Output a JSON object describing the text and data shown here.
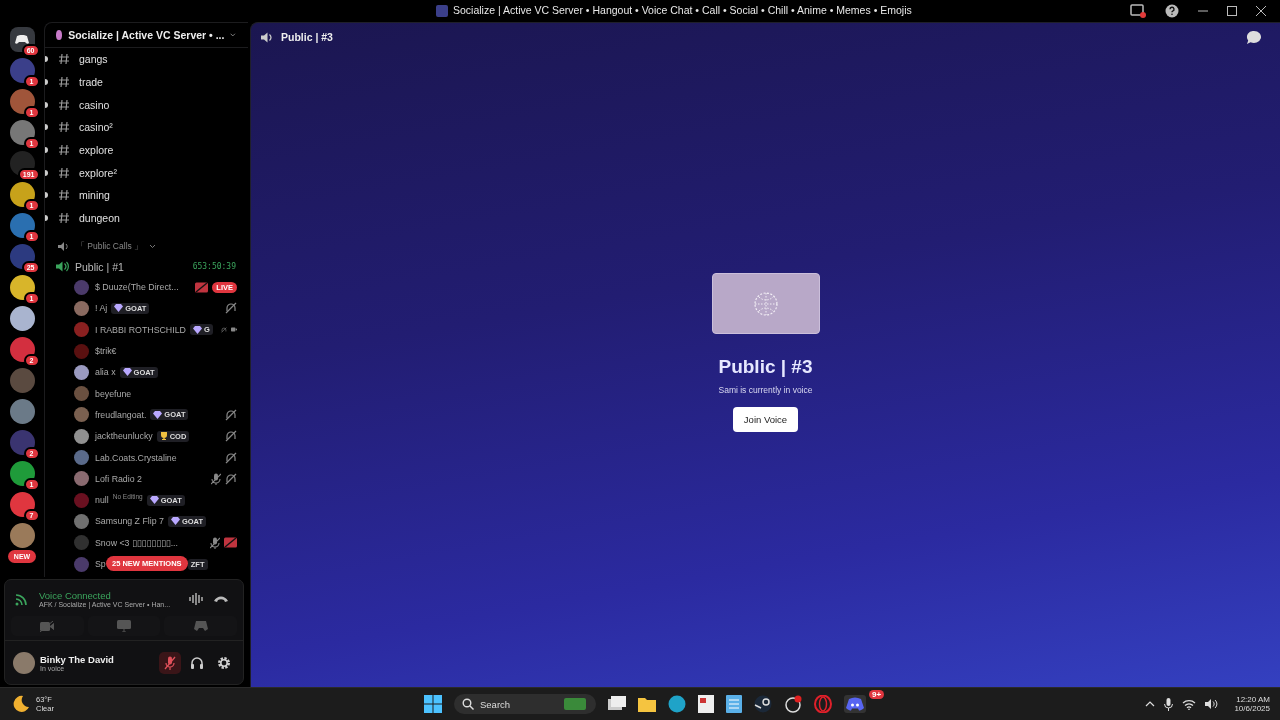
{
  "window": {
    "title": "Socialize | Active VC Server • Hangout • Voice Chat • Call • Social • Chill • Anime • Memes • Emojis",
    "inbox_unread": true
  },
  "servers": [
    {
      "badge": "60",
      "color": "#36393f",
      "kind": "home"
    },
    {
      "badge": "1",
      "color": "#3b3f8a",
      "kind": "server"
    },
    {
      "badge": "1",
      "color": "#a0553a",
      "kind": "server"
    },
    {
      "badge": "1",
      "color": "#777777",
      "kind": "server"
    },
    {
      "badge": "191",
      "color": "#222222",
      "kind": "server"
    },
    {
      "badge": "1",
      "color": "#c7a21a",
      "kind": "server"
    },
    {
      "badge": "1",
      "color": "#2a6fb0",
      "kind": "server"
    },
    {
      "badge": "25",
      "color": "#2c3a80",
      "kind": "server"
    },
    {
      "badge": "1",
      "color": "#d8b52a",
      "kind": "server"
    },
    {
      "color": "#a9b4cf",
      "kind": "server"
    },
    {
      "badge": "2",
      "color": "#d32f3f",
      "kind": "server"
    },
    {
      "color": "#5a4a40",
      "kind": "server"
    },
    {
      "color": "#6b7a88",
      "kind": "server"
    },
    {
      "badge": "2",
      "color": "#3a3470",
      "kind": "server"
    },
    {
      "badge": "1",
      "color": "#1f9b3a",
      "kind": "server"
    },
    {
      "badge": "7",
      "color": "#e0363f",
      "kind": "server"
    },
    {
      "color": "#9a7a5a",
      "kind": "server"
    }
  ],
  "new_pill": "NEW",
  "server_header": {
    "name": "Socialize | Active VC Server • ..."
  },
  "channels": [
    {
      "name": "gangs"
    },
    {
      "name": "trade"
    },
    {
      "name": "casino"
    },
    {
      "name": "casino²"
    },
    {
      "name": "explore"
    },
    {
      "name": "explore²"
    },
    {
      "name": "mining"
    },
    {
      "name": "dungeon"
    }
  ],
  "category": {
    "name": "「 Public Calls 」"
  },
  "voice_channel": {
    "name": "Public | #1",
    "timer": "653:50:39"
  },
  "members": [
    {
      "name": "$ Duuze(The Direct...",
      "status": [
        {
          "kind": "stream-off"
        }
      ],
      "live": "LIVE",
      "color": "#4b3a6a"
    },
    {
      "name": "! Aj",
      "tag": {
        "label": "GOAT",
        "kind": "gem"
      },
      "status": [
        {
          "kind": "deafened"
        }
      ],
      "color": "#8a6a60"
    },
    {
      "name": "I RABBI ROTHSCHILD",
      "tag": {
        "label": "G",
        "kind": "gem"
      },
      "status": [
        {
          "kind": "deafened"
        },
        {
          "kind": "video"
        }
      ],
      "color": "#8a2020"
    },
    {
      "name": "$trik€",
      "color": "#5a1010"
    },
    {
      "name": "alia x",
      "tag": {
        "label": "GOAT",
        "kind": "gem"
      },
      "color": "#9a9ac0"
    },
    {
      "name": "beyefune",
      "color": "#6a5040"
    },
    {
      "name": "freudlangoat.",
      "tag": {
        "label": "GOAT",
        "kind": "gem"
      },
      "status": [
        {
          "kind": "deafened"
        }
      ],
      "color": "#7a6050"
    },
    {
      "name": "jacktheunlucky",
      "tag": {
        "label": "COD",
        "kind": "trophy"
      },
      "status": [
        {
          "kind": "deafened"
        }
      ],
      "color": "#909090"
    },
    {
      "name": "Lab.Coats.Crystaline",
      "status": [
        {
          "kind": "deafened"
        }
      ],
      "color": "#5a6a8a"
    },
    {
      "name": "Lofi Radio 2",
      "status": [
        {
          "kind": "mic-muted"
        },
        {
          "kind": "deafened"
        }
      ],
      "color": "#8a6a70"
    },
    {
      "name": "null",
      "note": "No Editing",
      "tag": {
        "label": "GOAT",
        "kind": "gem"
      },
      "color": "#6a1020"
    },
    {
      "name": "Samsung Z Flip 7",
      "tag": {
        "label": "GOAT",
        "kind": "gem"
      },
      "color": "#707070"
    },
    {
      "name": "Snow <3 ▯▯▯▯▯▯▯▯...",
      "status": [
        {
          "kind": "mic-muted"
        },
        {
          "kind": "stream-off"
        }
      ],
      "color": "#303030"
    },
    {
      "name": "Sp",
      "tag": {
        "label": "ZFT",
        "kind": "plain"
      },
      "color": "#4a3a6a"
    }
  ],
  "mentions_pill": "25 NEW MENTIONS",
  "voice_panel": {
    "status": "Voice Connected",
    "location": "AFK / Socialize | Active VC Server • Han..."
  },
  "user_panel": {
    "name": "Binky The David",
    "status": "In voice",
    "mic_muted": true
  },
  "main": {
    "channel": "Public | #3",
    "title": "Public | #3",
    "subtitle": "Sami is currently in voice",
    "join_button": "Join Voice"
  },
  "taskbar": {
    "temperature": "63°F",
    "weather": "Clear",
    "search_placeholder": "Search",
    "discord_badge": "9+",
    "time": "12:20 AM",
    "date": "10/6/2025"
  }
}
